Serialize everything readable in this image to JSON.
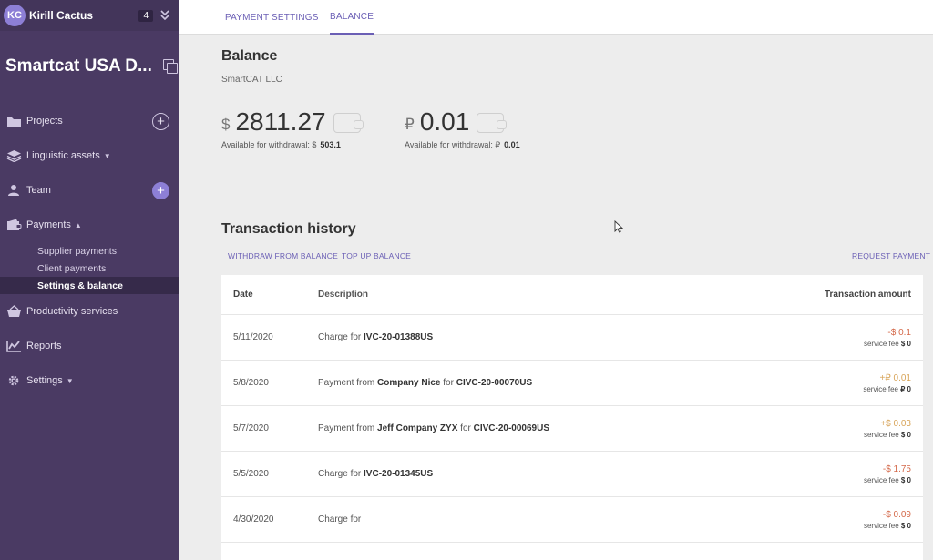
{
  "user": {
    "initials": "KC",
    "name": "Kirill Cactus",
    "notifications": "4"
  },
  "company": {
    "name": "Smartcat USA D..."
  },
  "nav": {
    "projects": "Projects",
    "linguistic_assets": "Linguistic assets",
    "team": "Team",
    "payments": "Payments",
    "supplier_payments": "Supplier payments",
    "client_payments": "Client payments",
    "settings_balance": "Settings & balance",
    "productivity": "Productivity services",
    "reports": "Reports",
    "settings": "Settings"
  },
  "tabs": {
    "payment_settings": "PAYMENT SETTINGS",
    "balance": "BALANCE"
  },
  "balance": {
    "title": "Balance",
    "company": "SmartCAT LLC",
    "usd": {
      "symbol": "$",
      "amount": "2811.27",
      "avail_label": "Available for withdrawal: $",
      "avail_value": "503.1"
    },
    "rub": {
      "symbol": "₽",
      "amount": "0.01",
      "avail_label": "Available for withdrawal: ₽",
      "avail_value": "0.01"
    }
  },
  "history": {
    "title": "Transaction history",
    "withdraw": "WITHDRAW FROM BALANCE",
    "top_up": "TOP UP BALANCE",
    "request": "REQUEST PAYMENT",
    "columns": {
      "date": "Date",
      "description": "Description",
      "amount": "Transaction amount"
    },
    "rows": [
      {
        "date": "5/11/2020",
        "desc_prefix": "Charge for ",
        "party": "",
        "desc_mid": "",
        "ref": "IVC-20-01388US",
        "amount": "-$ 0.1",
        "fee_label": "service fee",
        "fee": "$ 0"
      },
      {
        "date": "5/8/2020",
        "desc_prefix": "Payment from ",
        "party": "Company Nice",
        "desc_mid": " for ",
        "ref": "CIVC-20-00070US",
        "amount": "+₽ 0.01",
        "fee_label": "service fee",
        "fee": "₽ 0"
      },
      {
        "date": "5/7/2020",
        "desc_prefix": "Payment from ",
        "party": "Jeff Company ZYX",
        "desc_mid": " for ",
        "ref": "CIVC-20-00069US",
        "amount": "+$ 0.03",
        "fee_label": "service fee",
        "fee": "$ 0"
      },
      {
        "date": "5/5/2020",
        "desc_prefix": "Charge for ",
        "party": "",
        "desc_mid": "",
        "ref": "IVC-20-01345US",
        "amount": "-$ 1.75",
        "fee_label": "service fee",
        "fee": "$ 0"
      },
      {
        "date": "4/30/2020",
        "desc_prefix": "Charge for",
        "party": "",
        "desc_mid": "",
        "ref": "",
        "amount": "-$ 0.09",
        "fee_label": "service fee",
        "fee": "$ 0"
      }
    ]
  },
  "colors": {
    "sidebar": "#4a3a63",
    "accent": "#6b5fb5",
    "negative": "#d4694a",
    "positive": "#d8a55a"
  }
}
